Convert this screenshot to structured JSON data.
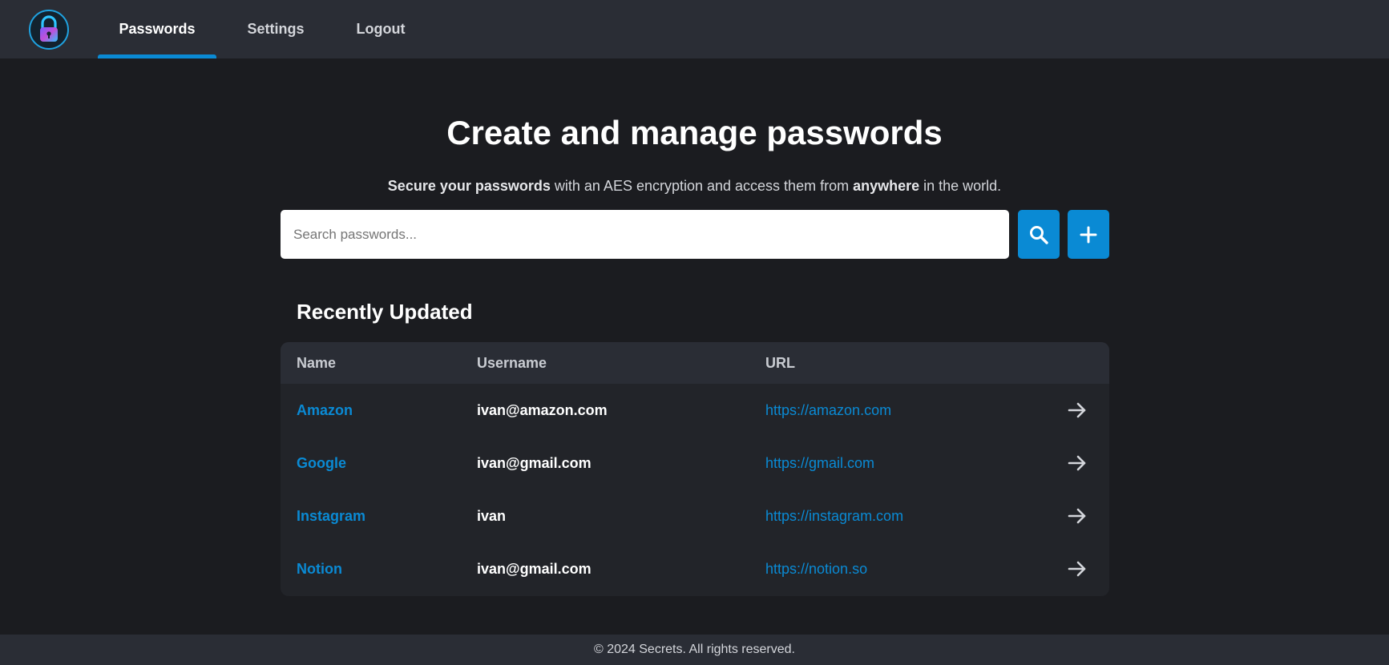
{
  "nav": {
    "items": [
      {
        "label": "Passwords"
      },
      {
        "label": "Settings"
      },
      {
        "label": "Logout"
      }
    ]
  },
  "hero": {
    "title": "Create and manage passwords",
    "subtitle_part1": "Secure your passwords",
    "subtitle_part2": " with an AES encryption and access them from ",
    "subtitle_part3": "anywhere",
    "subtitle_part4": " in the world."
  },
  "search": {
    "placeholder": "Search passwords..."
  },
  "recent": {
    "title": "Recently Updated",
    "columns": {
      "name": "Name",
      "username": "Username",
      "url": "URL"
    },
    "rows": [
      {
        "name": "Amazon",
        "username": "ivan@amazon.com",
        "url": "https://amazon.com"
      },
      {
        "name": "Google",
        "username": "ivan@gmail.com",
        "url": "https://gmail.com"
      },
      {
        "name": "Instagram",
        "username": "ivan",
        "url": "https://instagram.com"
      },
      {
        "name": "Notion",
        "username": "ivan@gmail.com",
        "url": "https://notion.so"
      }
    ]
  },
  "footer": {
    "text": "© 2024 Secrets. All rights reserved."
  },
  "colors": {
    "accent": "#0a8ad4",
    "background": "#1b1c20",
    "navbar": "#2a2d35",
    "card": "#222429"
  },
  "icons": [
    "lock-logo-icon",
    "search-icon",
    "plus-icon",
    "arrow-right-icon"
  ]
}
